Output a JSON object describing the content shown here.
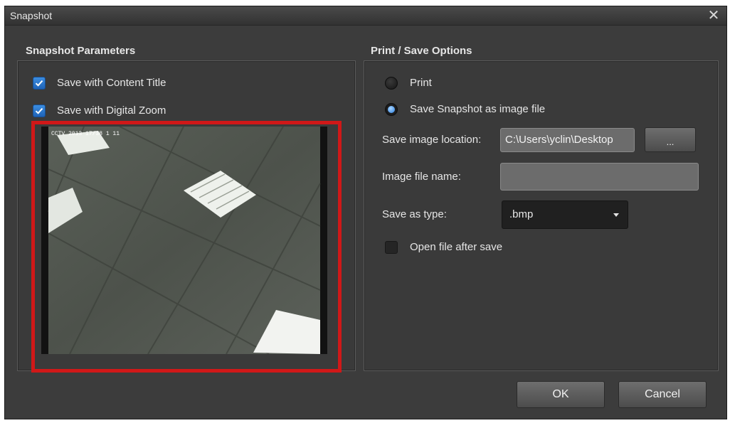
{
  "window": {
    "title": "Snapshot",
    "close_symbol": "✕"
  },
  "left_section": {
    "title": "Snapshot Parameters",
    "options": [
      {
        "label": "Save with Content Title",
        "checked": true
      },
      {
        "label": "Save with Digital Zoom",
        "checked": true
      }
    ],
    "preview_overlay_text": "CCTV 2013 17/38 1 11"
  },
  "right_section": {
    "title": "Print / Save Options",
    "radio_print": {
      "label": "Print",
      "selected": false
    },
    "radio_save": {
      "label": "Save Snapshot as image file",
      "selected": true
    },
    "location_label": "Save image location:",
    "location_value": "C:\\Users\\yclin\\Desktop",
    "browse_label": "...",
    "filename_label": "Image file name:",
    "filename_value": "",
    "type_label": "Save as type:",
    "type_value": ".bmp",
    "open_after_save": {
      "label": "Open file after save",
      "checked": false
    }
  },
  "footer": {
    "ok_label": "OK",
    "cancel_label": "Cancel"
  },
  "colors": {
    "dialog_bg": "#3c3c3c",
    "highlight_border": "#d01818",
    "accent_blue": "#2a7de0"
  }
}
